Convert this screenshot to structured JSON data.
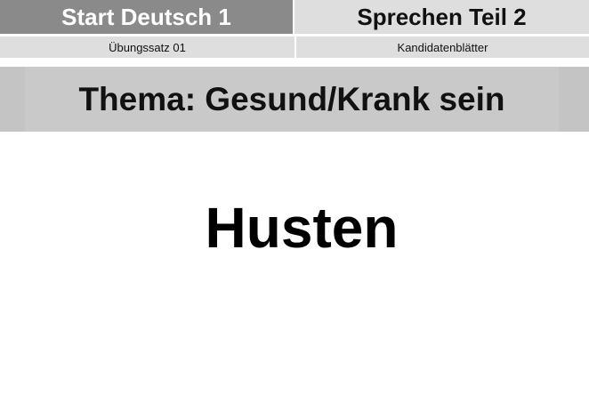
{
  "header": {
    "exam_title": "Start Deutsch 1",
    "section_title": "Sprechen Teil 2"
  },
  "subheader": {
    "set_label": "Übungssatz 01",
    "sheet_label": "Kandidatenblätter"
  },
  "topic": {
    "text": "Thema: Gesund/Krank sein"
  },
  "card": {
    "word": "Husten"
  },
  "colors": {
    "header_dark": "#8a8a8a",
    "header_light": "#dedede",
    "topic_band": "#c4c4c4",
    "background": "#ffffff"
  }
}
